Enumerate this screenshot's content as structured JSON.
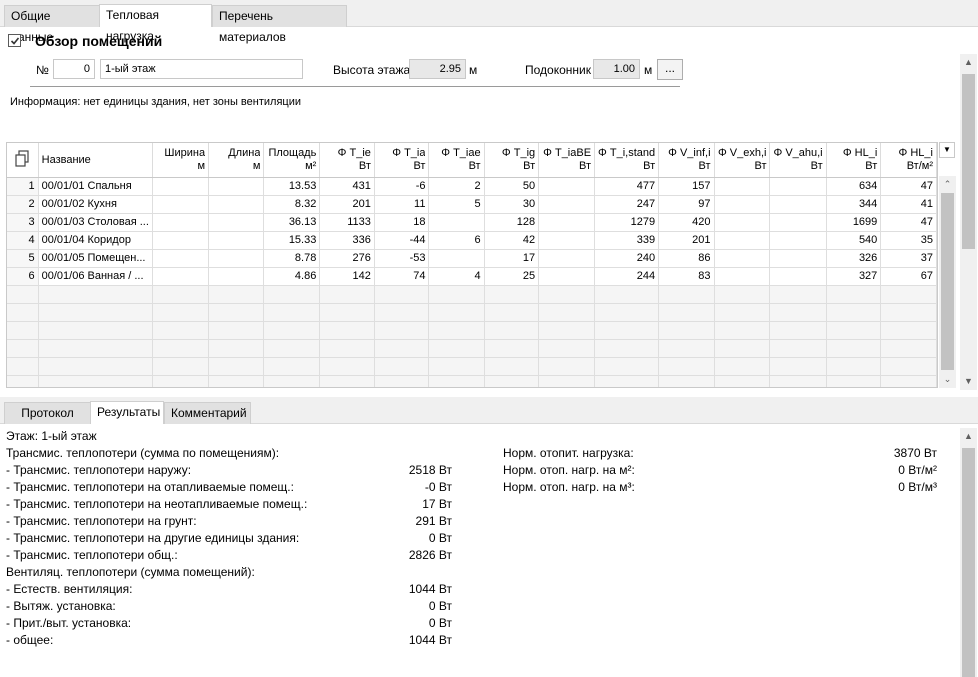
{
  "top_tabs": [
    "Общие данные",
    "Тепловая нагрузка",
    "Перечень материалов"
  ],
  "section_title": "Обзор помещений",
  "floor": {
    "num_label": "№",
    "num_value": "0",
    "name_value": "1-ый этаж",
    "height_label": "Высота этажа",
    "height_value": "2.95",
    "height_unit": "м",
    "sill_label": "Подоконник",
    "sill_value": "1.00",
    "sill_unit": "м",
    "more_button": "..."
  },
  "info_text": "Информация: нет единицы здания, нет зоны вентиляции",
  "grid": {
    "headers": [
      {
        "top": "Название",
        "bottom": ""
      },
      {
        "top": "Ширина",
        "bottom": "м"
      },
      {
        "top": "Длина",
        "bottom": "м"
      },
      {
        "top": "Площадь",
        "bottom": "м²"
      },
      {
        "top": "Φ T_ie",
        "bottom": "Вт"
      },
      {
        "top": "Φ T_ia",
        "bottom": "Вт"
      },
      {
        "top": "Φ T_iae",
        "bottom": "Вт"
      },
      {
        "top": "Φ T_ig",
        "bottom": "Вт"
      },
      {
        "top": "Φ T_iaBE",
        "bottom": "Вт"
      },
      {
        "top": "Φ T_i,stand",
        "bottom": "Вт"
      },
      {
        "top": "Φ V_inf,i",
        "bottom": "Вт"
      },
      {
        "top": "Φ V_exh,i",
        "bottom": "Вт"
      },
      {
        "top": "Φ V_ahu,i",
        "bottom": "Вт"
      },
      {
        "top": "Φ HL_i",
        "bottom": "Вт"
      },
      {
        "top": "Φ HL_i",
        "bottom": "Вт/м²"
      }
    ],
    "rows": [
      [
        "1",
        "00/01/01 Спальня",
        "",
        "",
        "13.53",
        "431",
        "-6",
        "2",
        "50",
        "",
        "477",
        "157",
        "",
        "",
        "634",
        "47"
      ],
      [
        "2",
        "00/01/02 Кухня",
        "",
        "",
        "8.32",
        "201",
        "11",
        "5",
        "30",
        "",
        "247",
        "97",
        "",
        "",
        "344",
        "41"
      ],
      [
        "3",
        "00/01/03 Столовая ...",
        "",
        "",
        "36.13",
        "1133",
        "18",
        "",
        "128",
        "",
        "1279",
        "420",
        "",
        "",
        "1699",
        "47"
      ],
      [
        "4",
        "00/01/04 Коридор",
        "",
        "",
        "15.33",
        "336",
        "-44",
        "6",
        "42",
        "",
        "339",
        "201",
        "",
        "",
        "540",
        "35"
      ],
      [
        "5",
        "00/01/05 Помещен...",
        "",
        "",
        "8.78",
        "276",
        "-53",
        "",
        "17",
        "",
        "240",
        "86",
        "",
        "",
        "326",
        "37"
      ],
      [
        "6",
        "00/01/06 Ванная / ...",
        "",
        "",
        "4.86",
        "142",
        "74",
        "4",
        "25",
        "",
        "244",
        "83",
        "",
        "",
        "327",
        "67"
      ]
    ]
  },
  "bottom_tabs": [
    "Протокол",
    "Результаты",
    "Комментарий"
  ],
  "results": {
    "floor_line": "Этаж: 1-ый этаж",
    "left": [
      {
        "label": "Трансмис. теплопотери (сумма по помещениям):",
        "value": ""
      },
      {
        "label": " - Трансмис. теплопотери наружу:",
        "value": "2518 Вт"
      },
      {
        "label": "- Трансмис. теплопотери на отапливаемые помещ.:",
        "value": "-0 Вт"
      },
      {
        "label": "- Трансмис. теплопотери на неотапливаемые помещ.:",
        "value": "17 Вт"
      },
      {
        "label": "- Трансмис. теплопотери на грунт:",
        "value": "291 Вт"
      },
      {
        "label": "- Трансмис. теплопотери на другие единицы здания:",
        "value": "0 Вт"
      },
      {
        "label": " - Трансмис. теплопотери общ.:",
        "value": "2826 Вт"
      },
      {
        "label": "Вентиляц. теплопотери (сумма помещений):",
        "value": ""
      },
      {
        "label": "- Естеств. вентиляция:",
        "value": "1044 Вт"
      },
      {
        "label": "- Вытяж. установка:",
        "value": "0 Вт"
      },
      {
        "label": "- Прит./выт. установка:",
        "value": "0 Вт"
      },
      {
        "label": " - общее:",
        "value": "1044 Вт"
      }
    ],
    "right": [
      {
        "label": "Норм. отопит. нагрузка:",
        "value": "3870 Вт"
      },
      {
        "label": "Норм. отоп. нагр. на м²:",
        "value": "0 Вт/м²"
      },
      {
        "label": "Норм. отоп. нагр. на м³:",
        "value": "0 Вт/м³"
      }
    ]
  },
  "colors": {
    "tab_bg": "#e1e1e1",
    "active_tab_bg": "#ffffff",
    "readonly_bg": "#e8e8e8",
    "grid_bg": "#f5f5f5"
  }
}
